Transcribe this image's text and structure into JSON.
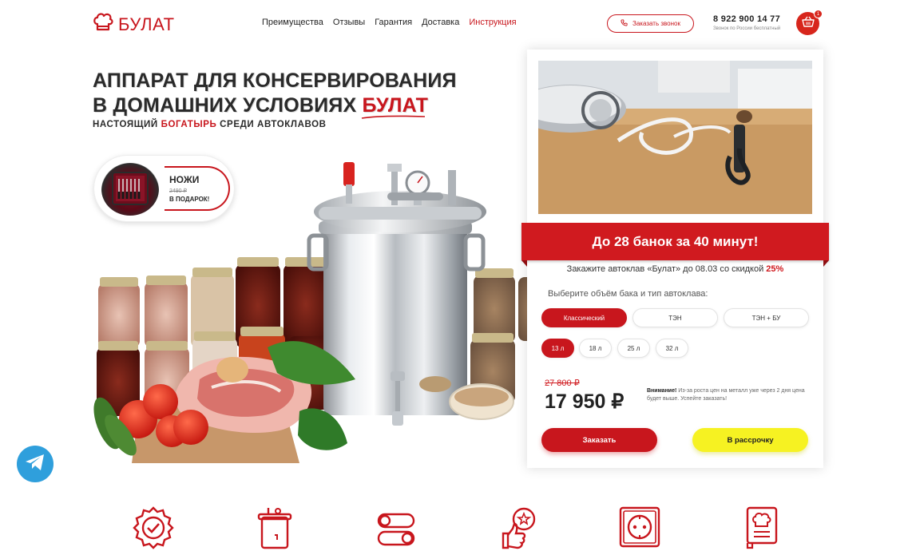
{
  "header": {
    "logo_text": "БУЛАТ",
    "nav": [
      "Преимущества",
      "Отзывы",
      "Гарантия",
      "Доставка",
      "Инструкция"
    ],
    "call_button": "Заказать звонок",
    "phone": "8 922 900 14 77",
    "phone_note": "Звонок по России бесплатный",
    "cart_count": "1"
  },
  "hero": {
    "title_line1": "АППАРАТ ДЛЯ КОНСЕРВИРОВАНИЯ",
    "title_line2": "В ДОМАШНИХ УСЛОВИЯХ",
    "title_brand": "БУЛАТ",
    "subtitle_before": "НАСТОЯЩИЙ",
    "subtitle_accent": "БОГАТЫРЬ",
    "subtitle_after": "СРЕДИ АВТОКЛАВОВ"
  },
  "gift": {
    "title": "НОЖИ",
    "old_price": "2490 ₽",
    "label": "В ПОДАРОК!"
  },
  "order": {
    "ribbon": "До 28 банок за 40 минут!",
    "promo_text": "Закажите автоклав «Булат» до 08.03 со скидкой",
    "promo_percent": "25%",
    "select_label": "Выберите объём бака и тип автоклава:",
    "types": [
      "Классический",
      "ТЭН",
      "ТЭН + БУ"
    ],
    "volumes": [
      "13 л",
      "18 л",
      "25 л",
      "32 л"
    ],
    "old_price": "27 800 ₽",
    "price": "17 950 ₽",
    "warning_label": "Внимание!",
    "warning_text": "Из-за роста цен на металл уже через 2 дня цена будет выше. Успейте заказать!",
    "order_button": "Заказать",
    "credit_button": "В рассрочку"
  },
  "colors": {
    "brand_red": "#c8161d",
    "ribbon_red": "#d01a1f",
    "credit_yellow": "#f6f222",
    "telegram_blue": "#2f9fdc"
  },
  "icons": {
    "features": [
      "quality-badge-icon",
      "pressure-cooker-icon",
      "toggle-switches-icon",
      "thumbs-up-award-icon",
      "power-socket-icon",
      "recipe-book-icon"
    ]
  }
}
